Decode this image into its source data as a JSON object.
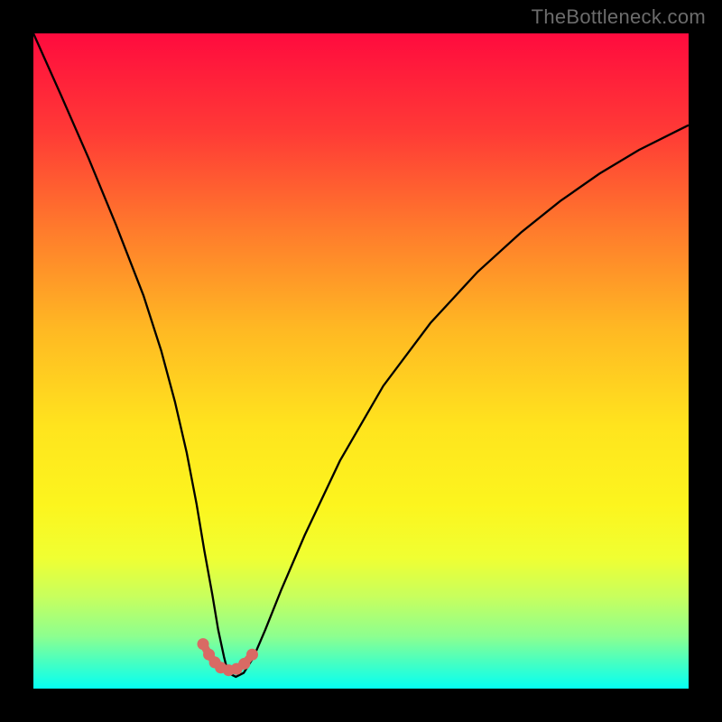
{
  "watermark": "TheBottleneck.com",
  "chart_data": {
    "type": "line",
    "title": "",
    "xlabel": "",
    "ylabel": "",
    "xlim": [
      0,
      1000
    ],
    "ylim": [
      0,
      1000
    ],
    "series": [
      {
        "name": "curve",
        "x": [
          0,
          42,
          84,
          126,
          168,
          195,
          216,
          234,
          249,
          261,
          273,
          282,
          291,
          297,
          309,
          321,
          336,
          354,
          378,
          414,
          468,
          534,
          606,
          678,
          744,
          804,
          864,
          924,
          984,
          1000
        ],
        "y": [
          1000,
          906,
          810,
          708,
          600,
          516,
          438,
          360,
          282,
          210,
          144,
          90,
          48,
          24,
          18,
          24,
          48,
          90,
          150,
          234,
          348,
          462,
          558,
          636,
          696,
          744,
          786,
          822,
          852,
          860
        ]
      }
    ],
    "markers": {
      "name": "highlight-range",
      "x": [
        259,
        268,
        277,
        286,
        298,
        310,
        322,
        334
      ],
      "y": [
        68,
        52,
        40,
        32,
        28,
        30,
        38,
        52
      ]
    },
    "background_gradient": {
      "type": "vertical",
      "stops": [
        {
          "pos": 0.0,
          "color": "#ff0b3e"
        },
        {
          "pos": 0.3,
          "color": "#ff7b2c"
        },
        {
          "pos": 0.6,
          "color": "#ffe41e"
        },
        {
          "pos": 0.82,
          "color": "#e9ff3e"
        },
        {
          "pos": 1.0,
          "color": "#05fff2"
        }
      ]
    }
  }
}
